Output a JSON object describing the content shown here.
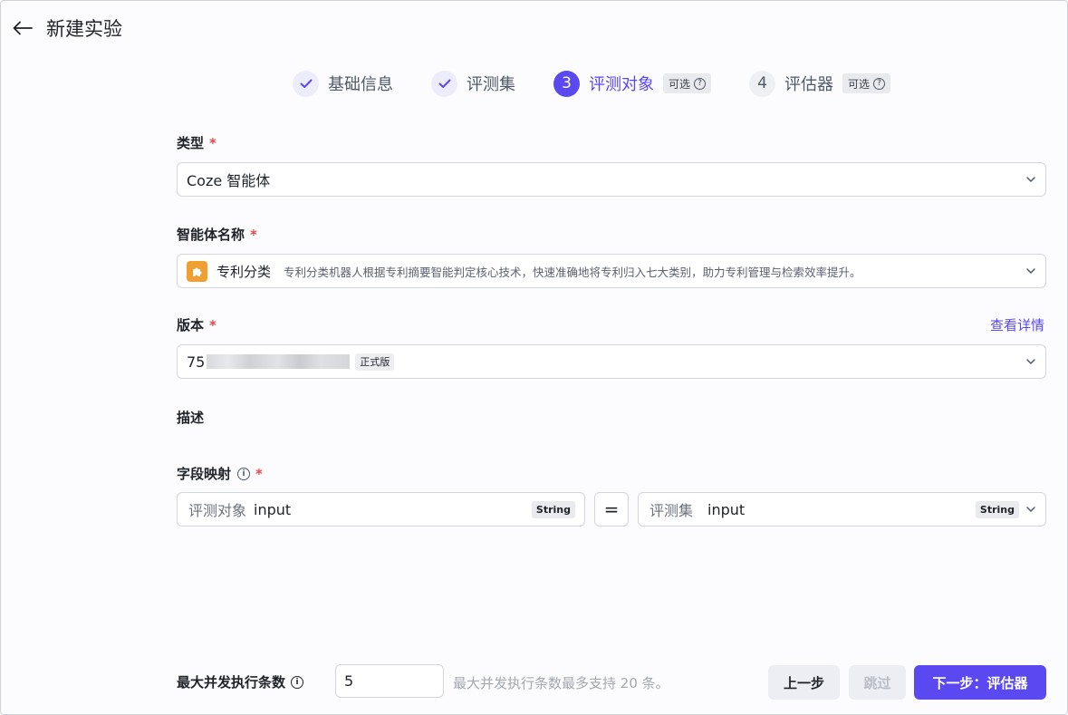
{
  "header": {
    "title": "新建实验"
  },
  "steps": [
    {
      "label": "基础信息",
      "status": "done"
    },
    {
      "label": "评测集",
      "status": "done"
    },
    {
      "number": "3",
      "label": "评测对象",
      "status": "active",
      "tag": "可选"
    },
    {
      "number": "4",
      "label": "评估器",
      "status": "todo",
      "tag": "可选"
    }
  ],
  "form": {
    "type": {
      "label": "类型",
      "required": "*",
      "value": "Coze 智能体"
    },
    "agent": {
      "label": "智能体名称",
      "required": "*",
      "name": "专利分类",
      "description": "专利分类机器人根据专利摘要智能判定核心技术，快速准确地将专利归入七大类别，助力专利管理与检索效率提升。"
    },
    "version": {
      "label": "版本",
      "required": "*",
      "value_prefix": "75",
      "tag": "正式版",
      "detail_link": "查看详情"
    },
    "description": {
      "label": "描述"
    },
    "mapping": {
      "label": "字段映射",
      "required": "*",
      "left": {
        "prefix": "评测对象",
        "field": "input",
        "type": "String"
      },
      "operator": "=",
      "right": {
        "prefix": "评测集",
        "field": "input",
        "type": "String"
      }
    }
  },
  "footer": {
    "concurrency_label": "最大并发执行条数",
    "concurrency_value": "5",
    "concurrency_hint": "最大并发执行条数最多支持 20 条。",
    "prev_label": "上一步",
    "skip_label": "跳过",
    "next_label": "下一步：评估器"
  },
  "colors": {
    "accent": "#5a48f0",
    "required": "#e5484d"
  }
}
